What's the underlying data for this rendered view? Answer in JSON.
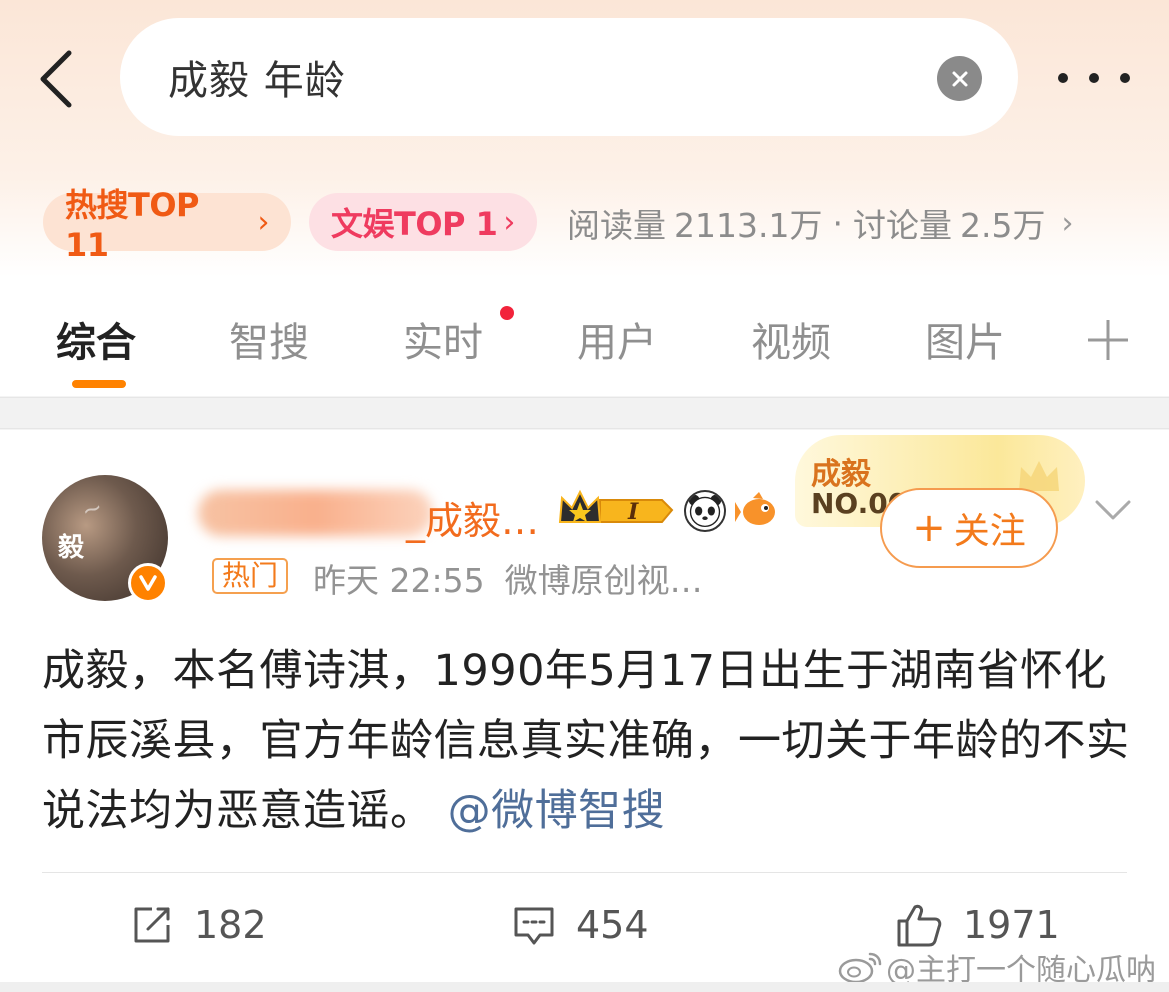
{
  "search": {
    "query": "成毅 年龄"
  },
  "topic": {
    "hot_badge": "热搜TOP 11",
    "ent_badge": "文娱TOP 1",
    "badge_arrow": "›",
    "reads_label": "阅读量",
    "reads_value": "2113.1万",
    "separator": "·",
    "discuss_label": "讨论量",
    "discuss_value": "2.5万",
    "stats_arrow": "›"
  },
  "tabs": [
    {
      "label": "综合",
      "active": true
    },
    {
      "label": "智搜",
      "active": false
    },
    {
      "label": "实时",
      "active": false,
      "dot": true
    },
    {
      "label": "用户",
      "active": false
    },
    {
      "label": "视频",
      "active": false
    },
    {
      "label": "图片",
      "active": false
    }
  ],
  "post": {
    "avatar_text": "毅",
    "username": "_成毅…",
    "rank_name": "成毅",
    "rank_no": "NO.00",
    "follow_label": "关注",
    "follow_plus": "+",
    "hot_tag": "热门",
    "time": "昨天 22:55",
    "source": "微博原创视…",
    "body": "成毅，本名傅诗淇，1990年5月17日出生于湖南省怀化市辰溪县，官方年龄信息真实准确，一切关于年龄的不实说法均为恶意造谣。",
    "mention": "@微博智搜"
  },
  "actions": {
    "repost_count": "182",
    "comment_count": "454",
    "like_count": "1971"
  },
  "watermark": "@主打一个随心瓜呐",
  "colors": {
    "accent": "#ff8200",
    "hot_badge_text": "#f05a14",
    "ent_badge_text": "#ef3b5f",
    "mention": "#4f6e99",
    "dot": "#f2233b"
  },
  "icons": {
    "back": "chevron-left-icon",
    "clear": "close-circle-icon",
    "more": "more-dots-icon",
    "add_tab": "plus-icon",
    "verified": "verified-v-icon",
    "crown": "crown-icon",
    "panda": "panda-emoji-icon",
    "fish": "fish-emoji-icon",
    "expand": "chevron-down-icon",
    "repost": "repost-icon",
    "comment": "comment-icon",
    "like": "thumbs-up-icon",
    "weibo_logo": "weibo-logo-icon"
  }
}
